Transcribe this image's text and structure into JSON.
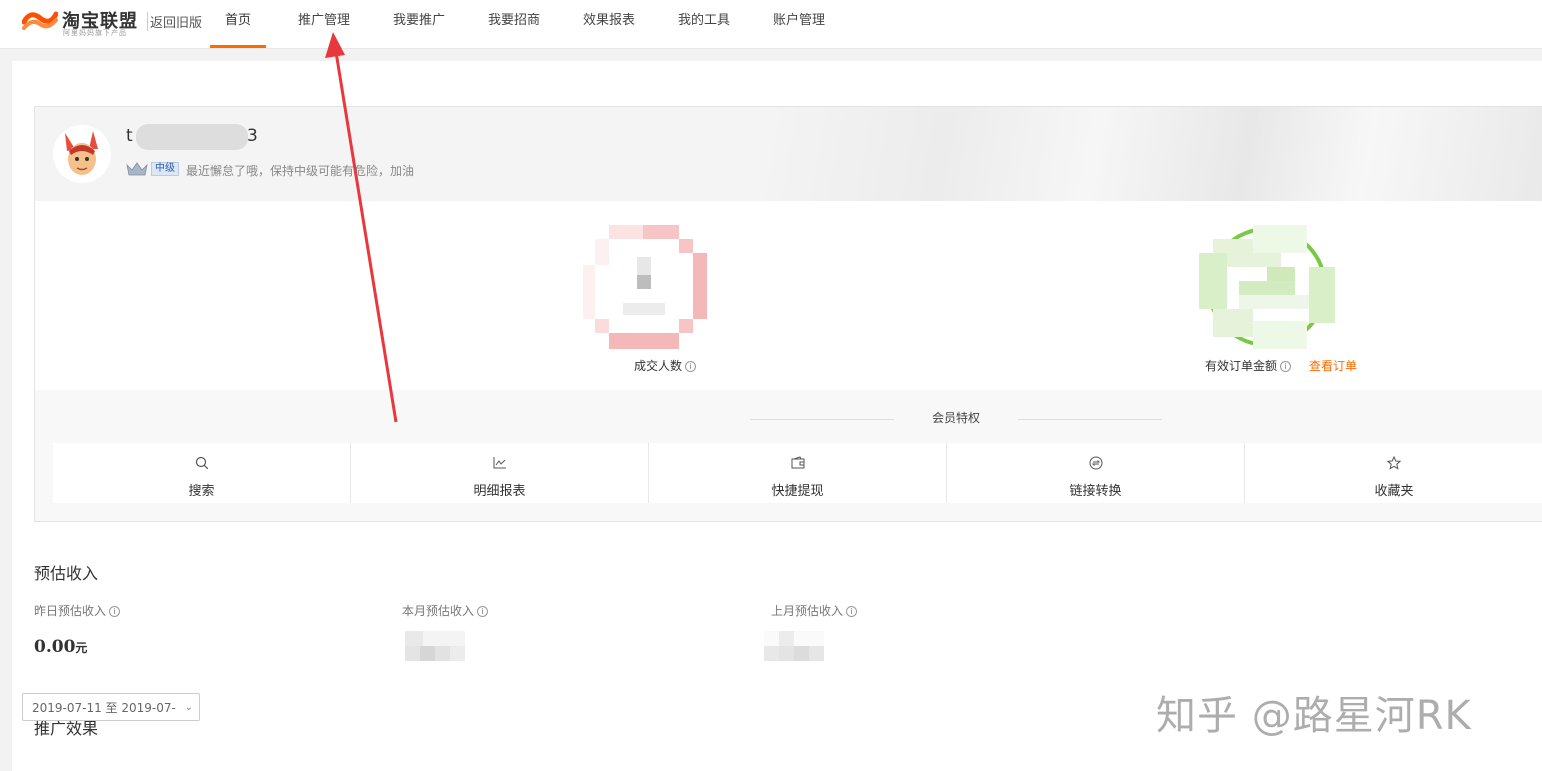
{
  "header": {
    "logo_title": "淘宝联盟",
    "logo_subtitle": "阿里妈妈旗下产品",
    "back_old_label": "返回旧版",
    "nav": [
      {
        "label": "首页",
        "active": true
      },
      {
        "label": "推广管理",
        "active": false
      },
      {
        "label": "我要推广",
        "active": false
      },
      {
        "label": "我要招商",
        "active": false
      },
      {
        "label": "效果报表",
        "active": false
      },
      {
        "label": "我的工具",
        "active": false
      },
      {
        "label": "账户管理",
        "active": false
      }
    ]
  },
  "profile": {
    "username_start": "t",
    "username_end": "3",
    "level": "中级",
    "level_note": "最近懈怠了哦，保持中级可能有危险，加油"
  },
  "metrics": {
    "deal_people_label": "成交人数",
    "valid_order_amount_label": "有效订单金额",
    "view_orders_link": "查看订单",
    "deal_ring_color": "#f5a9a9",
    "order_ring_color": "#7ac943"
  },
  "perks": {
    "title": "会员特权",
    "items": [
      {
        "label": "搜索",
        "icon": "search-icon"
      },
      {
        "label": "明细报表",
        "icon": "chart-icon"
      },
      {
        "label": "快捷提现",
        "icon": "wallet-icon"
      },
      {
        "label": "链接转换",
        "icon": "link-convert-icon"
      },
      {
        "label": "收藏夹",
        "icon": "star-icon"
      }
    ]
  },
  "estimated_income": {
    "title": "预估收入",
    "yesterday_label": "昨日预估收入",
    "yesterday_value": "0.00",
    "yesterday_unit": "元",
    "this_month_label": "本月预估收入",
    "last_month_label": "上月预估收入"
  },
  "promotion": {
    "title": "推广效果",
    "date_range": "2019-07-11 至 2019-07-"
  },
  "watermark": "知乎 @路星河RK",
  "colors": {
    "accent": "#ff6a00",
    "annotation_arrow": "#e8383d"
  }
}
